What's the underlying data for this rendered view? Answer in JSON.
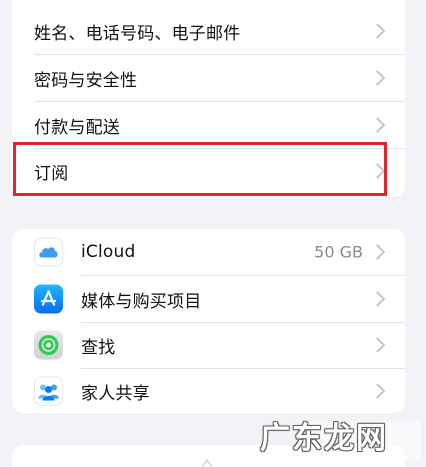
{
  "personal_group": {
    "items": [
      {
        "label": "姓名、电话号码、电子邮件"
      },
      {
        "label": "密码与安全性"
      },
      {
        "label": "付款与配送"
      },
      {
        "label": "订阅"
      }
    ]
  },
  "services_group": {
    "items": [
      {
        "label": "iCloud",
        "detail": "50 GB",
        "icon": "icloud-icon"
      },
      {
        "label": "媒体与购买项目",
        "icon": "app-store-icon"
      },
      {
        "label": "查找",
        "icon": "find-my-icon"
      },
      {
        "label": "家人共享",
        "icon": "family-sharing-icon"
      }
    ]
  },
  "watermark": {
    "text": "广东龙网"
  },
  "colors": {
    "background": "#f2f2f7",
    "highlight": "#e0262c",
    "chevron": "#c4c4c8"
  }
}
